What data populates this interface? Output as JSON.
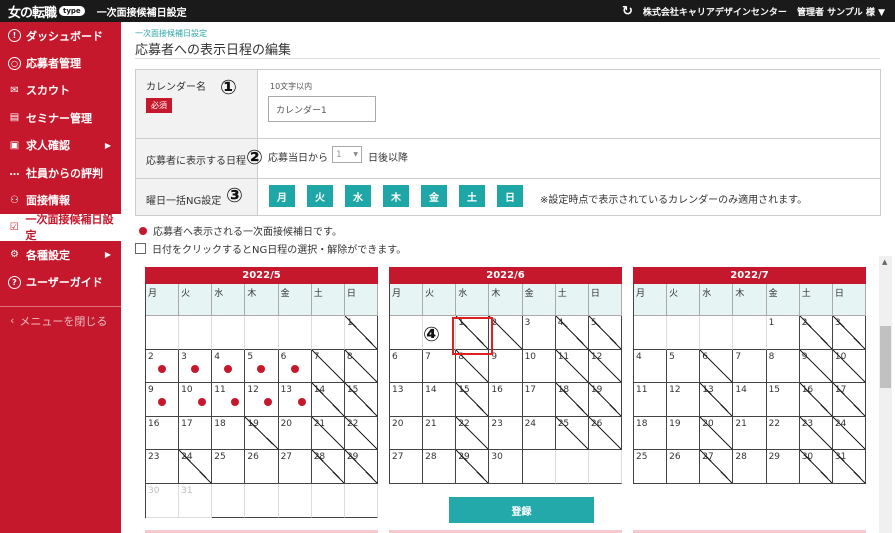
{
  "app": {
    "logo_text": "女の転職",
    "logo_badge": "type",
    "header_title": "一次面接候補日設定",
    "company": "株式会社キャリアデザインセンター",
    "user": "管理者 サンプル 様 ▼"
  },
  "sidebar": {
    "items": [
      {
        "label": "ダッシュボード",
        "icon": "dashboard-icon",
        "glyph": "!"
      },
      {
        "label": "応募者管理",
        "icon": "person-icon",
        "glyph": "○"
      },
      {
        "label": "スカウト",
        "icon": "mail-icon",
        "glyph": "✉"
      },
      {
        "label": "セミナー管理",
        "icon": "presentation-icon",
        "glyph": "▤"
      },
      {
        "label": "求人確認",
        "icon": "list-icon",
        "glyph": "▣",
        "arrow": "▶"
      },
      {
        "label": "社員からの評判",
        "icon": "chat-icon",
        "glyph": "…"
      },
      {
        "label": "面接情報",
        "icon": "people-icon",
        "glyph": "⚇"
      },
      {
        "label": "一次面接候補日設定",
        "icon": "calendar-check-icon",
        "glyph": "☑",
        "active": true
      },
      {
        "label": "各種設定",
        "icon": "gear-icon",
        "glyph": "⚙",
        "arrow": "▶"
      },
      {
        "label": "ユーザーガイド",
        "icon": "help-icon",
        "glyph": "?"
      }
    ],
    "close_label": "メニューを閉じる"
  },
  "page": {
    "breadcrumb": "一次面接候補日設定",
    "title": "応募者への表示日程の編集"
  },
  "form": {
    "calendar_name_label": "カレンダー名",
    "required": "必須",
    "hint": "10文字以内",
    "calendar_name_value": "カレンダー1",
    "display_label": "応募者に表示する日程",
    "display_prefix": "応募当日から",
    "display_days": "1",
    "display_suffix": "日後以降",
    "weekday_label": "曜日一括NG設定",
    "weekdays": [
      "月",
      "火",
      "水",
      "木",
      "金",
      "土",
      "日"
    ],
    "weekday_note": "※設定時点で表示されているカレンダーのみ適用されます。"
  },
  "annotations": [
    "①",
    "②",
    "③",
    "④"
  ],
  "legend": {
    "marker_text": "応募者へ表示される一次面接候補日です。",
    "click_text": "日付をクリックするとNG日程の選択・解除ができます。"
  },
  "calendars": [
    {
      "month": "2022/5",
      "lead": 6,
      "days": 31,
      "marked": [
        2,
        3,
        4,
        5,
        6,
        9,
        10,
        11,
        12,
        13
      ],
      "ng": [
        1,
        7,
        8,
        14,
        15,
        19,
        21,
        22,
        24,
        28,
        29
      ],
      "faded": [
        30,
        31
      ]
    },
    {
      "month": "2022/6",
      "lead": 2,
      "days": 30,
      "marked": [],
      "ng": [
        1,
        2,
        4,
        5,
        8,
        11,
        12,
        15,
        18,
        19,
        22,
        25,
        26,
        29
      ],
      "faded": []
    },
    {
      "month": "2022/7",
      "lead": 4,
      "days": 31,
      "marked": [],
      "ng": [
        2,
        3,
        6,
        9,
        10,
        13,
        16,
        17,
        20,
        23,
        24,
        27,
        30,
        31
      ],
      "faded": []
    }
  ],
  "weekday_headers": [
    "月",
    "火",
    "水",
    "木",
    "金",
    "土",
    "日"
  ],
  "register_label": "登録"
}
